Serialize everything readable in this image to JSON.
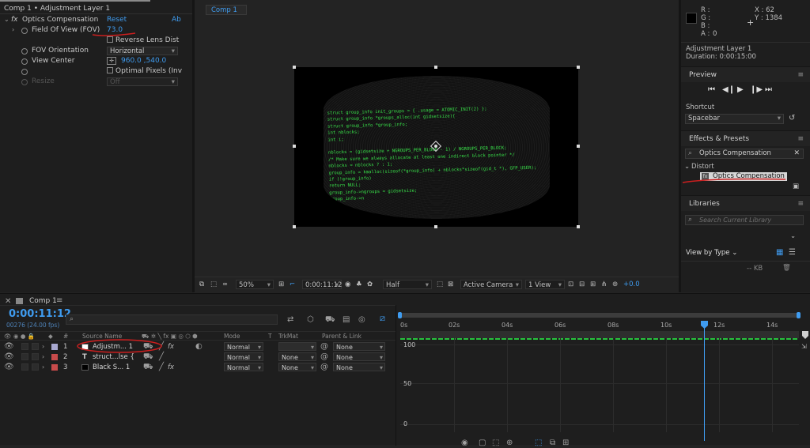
{
  "effect_controls": {
    "breadcrumb": "Comp 1 • Adjustment Layer 1",
    "fx_label": "fx",
    "effect_name": "Optics Compensation",
    "reset": "Reset",
    "about": "Ab",
    "props": {
      "fov_label": "Field Of View (FOV)",
      "fov_value": "73.0",
      "reverse_lens": "Reverse Lens Dist",
      "fov_orientation_label": "FOV Orientation",
      "fov_orientation_value": "Horizontal",
      "view_center_label": "View Center",
      "view_center_value": "960.0 ,540.0",
      "optimal_pixels": "Optimal Pixels (Inv",
      "resize_label": "Resize",
      "resize_value": "Off"
    }
  },
  "comp_tab": "Comp 1",
  "code_lines": [
    "struct group_info init_groups = { .usage = ATOMIC_INIT(2) };",
    "struct group_info *groups_alloc(int gidsetsize){",
    "  struct group_info *group_info;",
    "  int nblocks;",
    "  int i;",
    "",
    "  nblocks = (gidsetsize + NGROUPS_PER_BLOCK - 1) / NGROUPS_PER_BLOCK;",
    "  /* Make sure we always allocate at least one indirect block pointer */",
    "  nblocks = nblocks ? : 1;",
    "  group_info = kmalloc(sizeof(*group_info) + nblocks*sizeof(gid_t *), GFP_USER);",
    "  if (!group_info)",
    "    return NULL;",
    "  group_info->ngroups = gidsetsize;",
    "  group_info->n"
  ],
  "viewer_bar": {
    "zoom": "50%",
    "timecode": "0:00:11:12",
    "resolution": "Half",
    "camera": "Active Camera",
    "views": "1 View",
    "exposure": "+0.0"
  },
  "info": {
    "r": "R :",
    "g": "G :",
    "b": "B :",
    "a": "A :",
    "a_value": "0",
    "x": "X : 62",
    "y": "Y : 1384",
    "layer_name": "Adjustment Layer 1",
    "duration": "Duration: 0:00:15:00"
  },
  "preview": {
    "title": "Preview",
    "shortcut_label": "Shortcut",
    "shortcut_value": "Spacebar"
  },
  "effects_presets": {
    "title": "Effects & Presets",
    "search_value": "Optics Compensation",
    "category": "Distort",
    "result": "Optics Compensation"
  },
  "libraries": {
    "title": "Libraries",
    "search_placeholder": "Search Current Library",
    "view_by": "View by Type",
    "size": "-- KB"
  },
  "timeline": {
    "tab": "Comp 1",
    "timecode": "0:00:11:12",
    "frames": "00276 (24.00 fps)",
    "col_source": "Source Name",
    "col_mode": "Mode",
    "col_t": "T",
    "col_trkmat": "TrkMat",
    "col_parent": "Parent & Link",
    "layers": [
      {
        "num": "1",
        "name": "Adjustm... 1",
        "mode": "Normal",
        "trk": "",
        "parent": "None",
        "color": "#a8a8d0",
        "fill": "#ffffff"
      },
      {
        "num": "2",
        "name": "struct...lse {",
        "mode": "Normal",
        "trk": "None",
        "parent": "None",
        "color": "#c84b4b",
        "fill": ""
      },
      {
        "num": "3",
        "name": "Black S... 1",
        "mode": "Normal",
        "trk": "None",
        "parent": "None",
        "color": "#c84b4b",
        "fill": "#000000"
      }
    ],
    "ticks": [
      "0s",
      "02s",
      "04s",
      "06s",
      "08s",
      "10s",
      "12s",
      "14s"
    ],
    "graph_labels": [
      "100",
      "50",
      "0"
    ]
  },
  "accent": "#3f9cf0",
  "annotation_color": "#cc1f1f"
}
